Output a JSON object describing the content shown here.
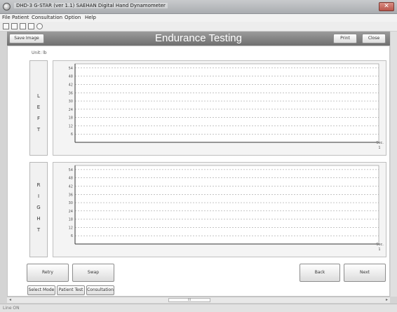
{
  "window": {
    "title": "DHD-3 G-STAR (ver 1.1) SAEHAN Digital Hand Dynamometer",
    "close_glyph": "✕"
  },
  "menu": [
    "File",
    "Patient",
    "Consultation",
    "Option",
    "Help"
  ],
  "toolbar_icons": [
    "new-icon",
    "save-icon",
    "edit-icon",
    "delete-icon",
    "search-icon"
  ],
  "header": {
    "save_image_label": "Save Image",
    "title": "Endurance Testing",
    "print_label": "Print",
    "close_label": "Close"
  },
  "unit_label": "Unit: lb",
  "charts": {
    "left": {
      "side_letters": [
        "L",
        "E",
        "F",
        "T"
      ],
      "y_ticks": [
        "54",
        "48",
        "42",
        "36",
        "30",
        "24",
        "18",
        "12",
        "6"
      ],
      "x_unit": "Sec.",
      "x_end": "1"
    },
    "right": {
      "side_letters": [
        "R",
        "I",
        "G",
        "H",
        "T"
      ],
      "y_ticks": [
        "54",
        "48",
        "42",
        "36",
        "30",
        "24",
        "18",
        "12",
        "6"
      ],
      "x_unit": "Sec.",
      "x_end": "1"
    }
  },
  "buttons": {
    "retry": "Retry",
    "swap": "Swap",
    "back": "Back",
    "next": "Next"
  },
  "tabs": [
    "Select Mode",
    "Patient Test",
    "Consultation"
  ],
  "scroll_thumb": "III",
  "status": "Line ON",
  "colors": {
    "header_bg": "#7f7f7f",
    "grid_line": "#8a8a8a",
    "plot_bg": "#f4f4f4"
  }
}
